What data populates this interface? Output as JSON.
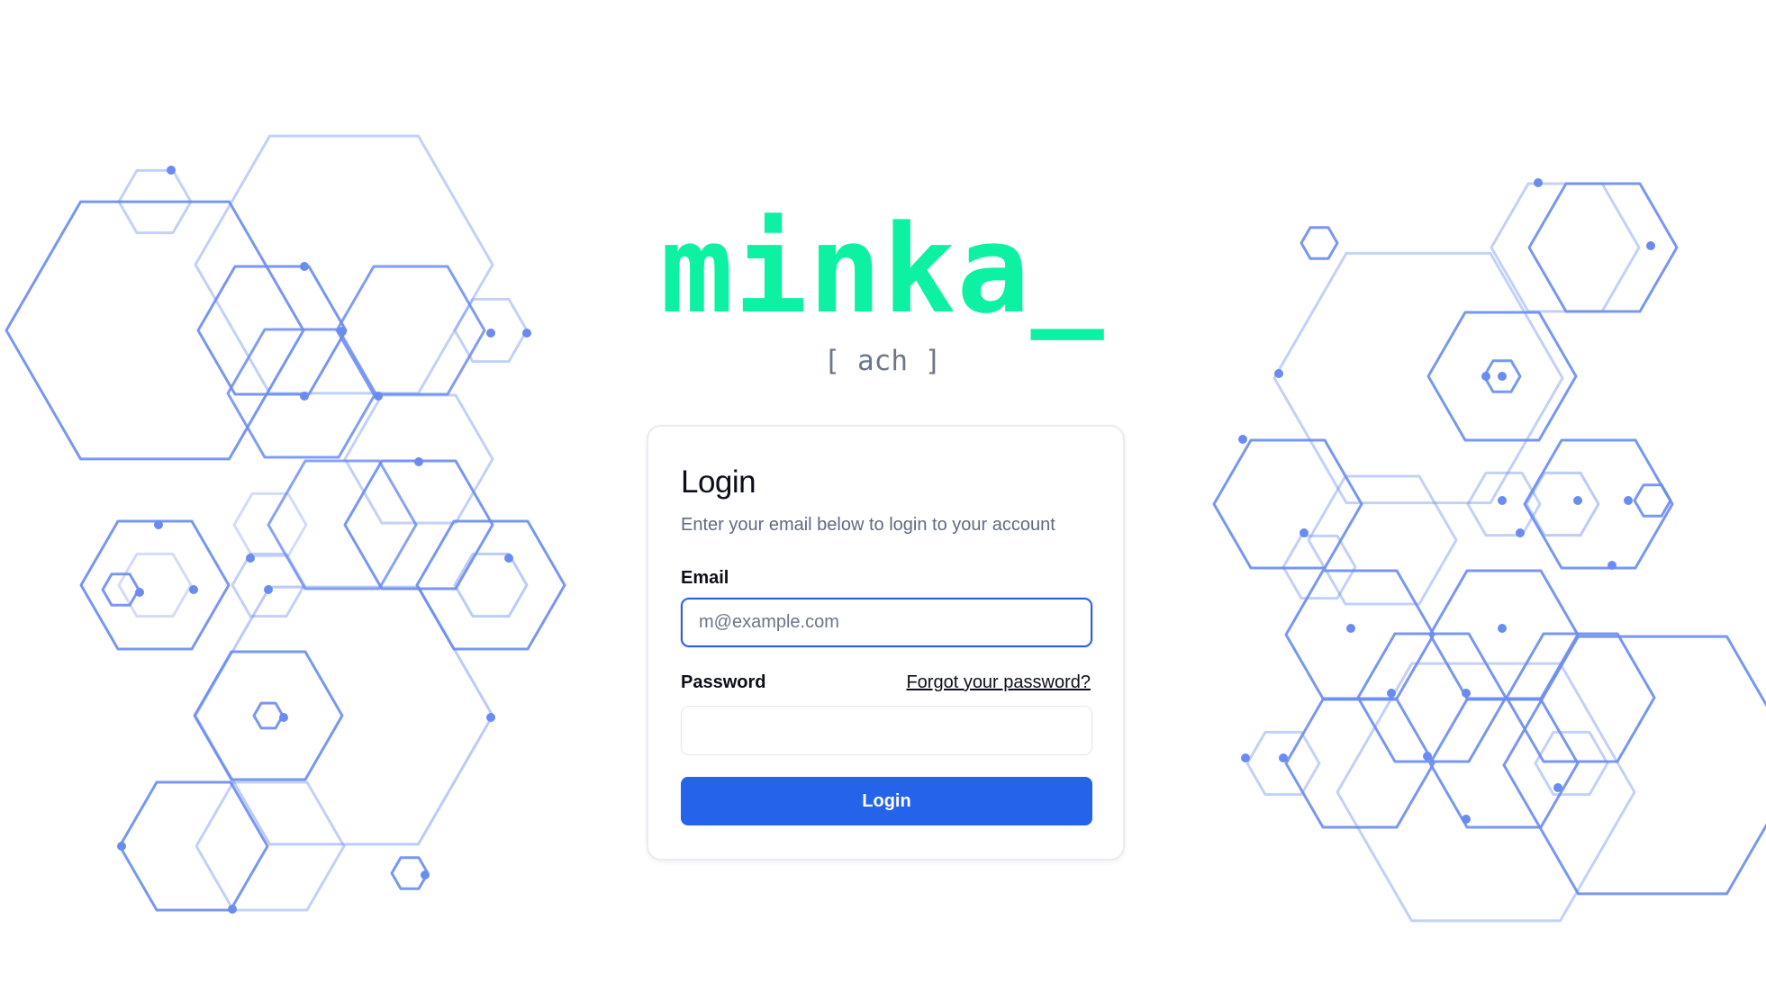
{
  "brand": {
    "logo_text": "minka_",
    "subtitle": "[ ach ]",
    "logo_color": "#0df2a2"
  },
  "login_card": {
    "title": "Login",
    "description": "Enter your email below to login to your account",
    "email_label": "Email",
    "email_placeholder": "m@example.com",
    "email_value": "",
    "password_label": "Password",
    "password_value": "",
    "forgot_password_label": "Forgot your password?",
    "submit_label": "Login",
    "button_color": "#2563eb"
  },
  "decoration": {
    "icon": "hexagon-network-pattern",
    "color": "#6a8cf0"
  }
}
